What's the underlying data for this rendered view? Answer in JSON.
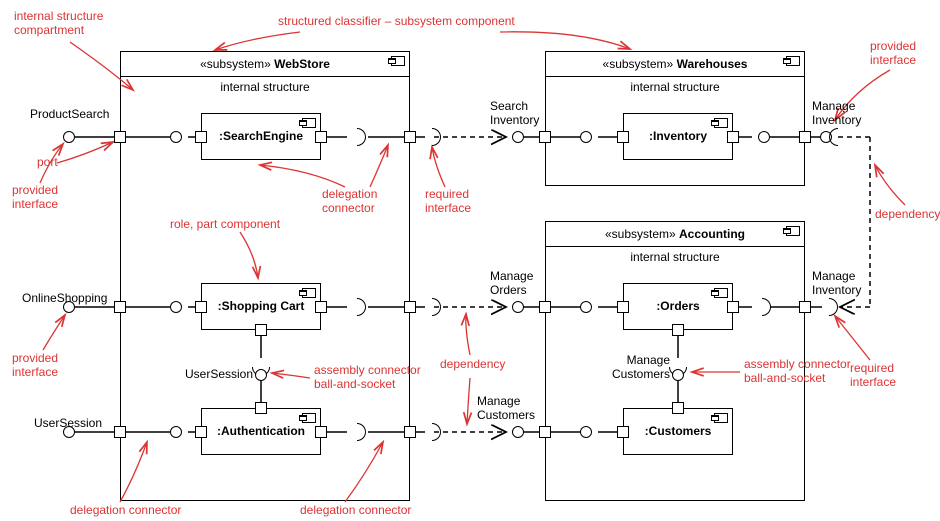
{
  "annotations": {
    "internal_structure_compartment": "internal structure\ncompartment",
    "structured_classifier": "structured classifier – subsystem component",
    "provided_interface_tr": "provided\ninterface",
    "port": "port",
    "provided_interface_l1": "provided\ninterface",
    "delegation_connector_1": "delegation\nconnector",
    "required_interface_1": "required\ninterface",
    "dependency_r": "dependency",
    "role_part_component": "role, part component",
    "manage_inventory_label": "Manage\nInventory",
    "required_interface_r": "required\ninterface",
    "provided_interface_l2": "provided\ninterface",
    "assembly_connector_ball_socket_1": "assembly connector\nball-and-socket",
    "dependency_c": "dependency",
    "assembly_connector_ball_socket_2": "assembly connector\nball-and-socket",
    "delegation_connector_bl": "delegation connector",
    "delegation_connector_bc": "delegation connector"
  },
  "labels": {
    "product_search": "ProductSearch",
    "search_inventory": "Search\nInventory",
    "manage_inventory_1": "Manage\nInventory",
    "online_shopping": "OnlineShopping",
    "manage_orders": "Manage\nOrders",
    "manage_inventory_2": "Manage\nInventory",
    "user_session_top": "UserSession",
    "manage_customers_top": "Manage\nCustomers",
    "manage_customers_left": "Manage\nCustomers",
    "user_session_left": "UserSession"
  },
  "subsystems": {
    "webstore": {
      "stereotype": "«subsystem»",
      "name": "WebStore",
      "sublabel": "internal structure"
    },
    "warehouses": {
      "stereotype": "«subsystem»",
      "name": "Warehouses",
      "sublabel": "internal structure"
    },
    "accounting": {
      "stereotype": "«subsystem»",
      "name": "Accounting",
      "sublabel": "internal structure"
    }
  },
  "components": {
    "search_engine": ":SearchEngine",
    "inventory": ":Inventory",
    "shopping_cart": ":Shopping Cart",
    "authentication": ":Authentication",
    "orders": ":Orders",
    "customers": ":Customers"
  }
}
